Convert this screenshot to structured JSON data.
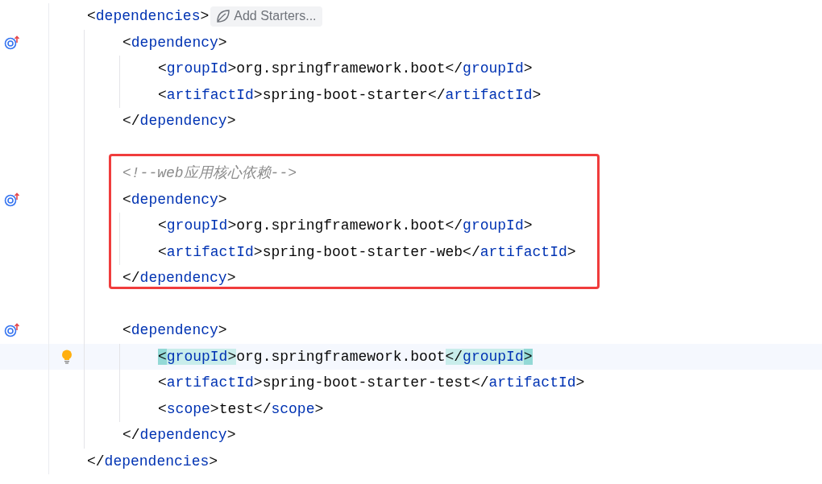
{
  "editor": {
    "lines": [
      {
        "tokens": [
          {
            "kind": "punct",
            "text": "<"
          },
          {
            "kind": "tag",
            "text": "dependencies"
          },
          {
            "kind": "punct",
            "text": ">"
          }
        ],
        "hint": "Add Starters...",
        "children": [
          {
            "tokens": [
              {
                "kind": "punct",
                "text": "<"
              },
              {
                "kind": "tag",
                "text": "dependency"
              },
              {
                "kind": "punct",
                "text": ">"
              }
            ],
            "gutter_marker": true,
            "children": [
              {
                "tokens": [
                  {
                    "kind": "punct",
                    "text": "<"
                  },
                  {
                    "kind": "tag",
                    "text": "groupId"
                  },
                  {
                    "kind": "punct",
                    "text": ">"
                  },
                  {
                    "kind": "text",
                    "text": "org.springframework.boot"
                  },
                  {
                    "kind": "punct",
                    "text": "</"
                  },
                  {
                    "kind": "tag",
                    "text": "groupId"
                  },
                  {
                    "kind": "punct",
                    "text": ">"
                  }
                ]
              },
              {
                "tokens": [
                  {
                    "kind": "punct",
                    "text": "<"
                  },
                  {
                    "kind": "tag",
                    "text": "artifactId"
                  },
                  {
                    "kind": "punct",
                    "text": ">"
                  },
                  {
                    "kind": "text",
                    "text": "spring-boot-starter"
                  },
                  {
                    "kind": "punct",
                    "text": "</"
                  },
                  {
                    "kind": "tag",
                    "text": "artifactId"
                  },
                  {
                    "kind": "punct",
                    "text": ">"
                  }
                ]
              }
            ]
          },
          {
            "tokens": [
              {
                "kind": "punct",
                "text": "</"
              },
              {
                "kind": "tag",
                "text": "dependency"
              },
              {
                "kind": "punct",
                "text": ">"
              }
            ]
          },
          {
            "kind": "blank"
          },
          {
            "kind": "annotation_box",
            "children": [
              {
                "tokens": [
                  {
                    "kind": "comment",
                    "text": "<!--web应用核心依赖-->"
                  }
                ]
              },
              {
                "tokens": [
                  {
                    "kind": "punct",
                    "text": "<"
                  },
                  {
                    "kind": "tag",
                    "text": "dependency"
                  },
                  {
                    "kind": "punct",
                    "text": ">"
                  }
                ],
                "gutter_marker": true,
                "children": [
                  {
                    "tokens": [
                      {
                        "kind": "punct",
                        "text": "<"
                      },
                      {
                        "kind": "tag",
                        "text": "groupId"
                      },
                      {
                        "kind": "punct",
                        "text": ">"
                      },
                      {
                        "kind": "text",
                        "text": "org.springframework.boot"
                      },
                      {
                        "kind": "punct",
                        "text": "</"
                      },
                      {
                        "kind": "tag",
                        "text": "groupId"
                      },
                      {
                        "kind": "punct",
                        "text": ">"
                      }
                    ]
                  },
                  {
                    "tokens": [
                      {
                        "kind": "punct",
                        "text": "<"
                      },
                      {
                        "kind": "tag",
                        "text": "artifactId"
                      },
                      {
                        "kind": "punct",
                        "text": ">"
                      },
                      {
                        "kind": "text",
                        "text": "spring-boot-starter-web"
                      },
                      {
                        "kind": "punct",
                        "text": "</"
                      },
                      {
                        "kind": "tag",
                        "text": "artifactId"
                      },
                      {
                        "kind": "punct",
                        "text": ">"
                      }
                    ]
                  }
                ]
              },
              {
                "tokens": [
                  {
                    "kind": "punct",
                    "text": "</"
                  },
                  {
                    "kind": "tag",
                    "text": "dependency"
                  },
                  {
                    "kind": "punct",
                    "text": ">"
                  }
                ]
              }
            ]
          },
          {
            "kind": "blank"
          },
          {
            "tokens": [
              {
                "kind": "punct",
                "text": "<"
              },
              {
                "kind": "tag",
                "text": "dependency"
              },
              {
                "kind": "punct",
                "text": ">"
              }
            ],
            "gutter_marker": true,
            "children": [
              {
                "tokens": [
                  {
                    "kind": "punct",
                    "text": "<",
                    "matched": true,
                    "caret": true
                  },
                  {
                    "kind": "tag",
                    "text": "groupId",
                    "matched": true
                  },
                  {
                    "kind": "punct",
                    "text": ">",
                    "matched": true
                  },
                  {
                    "kind": "text",
                    "text": "org.springframework.boot"
                  },
                  {
                    "kind": "punct",
                    "text": "</",
                    "matched": true
                  },
                  {
                    "kind": "tag",
                    "text": "groupId",
                    "matched": true
                  },
                  {
                    "kind": "punct",
                    "text": ">",
                    "matched": true,
                    "caret": true
                  }
                ],
                "current": true,
                "bulb": true
              },
              {
                "tokens": [
                  {
                    "kind": "punct",
                    "text": "<"
                  },
                  {
                    "kind": "tag",
                    "text": "artifactId"
                  },
                  {
                    "kind": "punct",
                    "text": ">"
                  },
                  {
                    "kind": "text",
                    "text": "spring-boot-starter-test"
                  },
                  {
                    "kind": "punct",
                    "text": "</"
                  },
                  {
                    "kind": "tag",
                    "text": "artifactId"
                  },
                  {
                    "kind": "punct",
                    "text": ">"
                  }
                ]
              },
              {
                "tokens": [
                  {
                    "kind": "punct",
                    "text": "<"
                  },
                  {
                    "kind": "tag",
                    "text": "scope"
                  },
                  {
                    "kind": "punct",
                    "text": ">"
                  },
                  {
                    "kind": "text",
                    "text": "test"
                  },
                  {
                    "kind": "punct",
                    "text": "</"
                  },
                  {
                    "kind": "tag",
                    "text": "scope"
                  },
                  {
                    "kind": "punct",
                    "text": ">"
                  }
                ]
              }
            ]
          },
          {
            "tokens": [
              {
                "kind": "punct",
                "text": "</"
              },
              {
                "kind": "tag",
                "text": "dependency"
              },
              {
                "kind": "punct",
                "text": ">"
              }
            ]
          }
        ]
      },
      {
        "tokens": [
          {
            "kind": "punct",
            "text": "</"
          },
          {
            "kind": "tag",
            "text": "dependencies"
          },
          {
            "kind": "punct",
            "text": ">"
          }
        ]
      }
    ]
  }
}
